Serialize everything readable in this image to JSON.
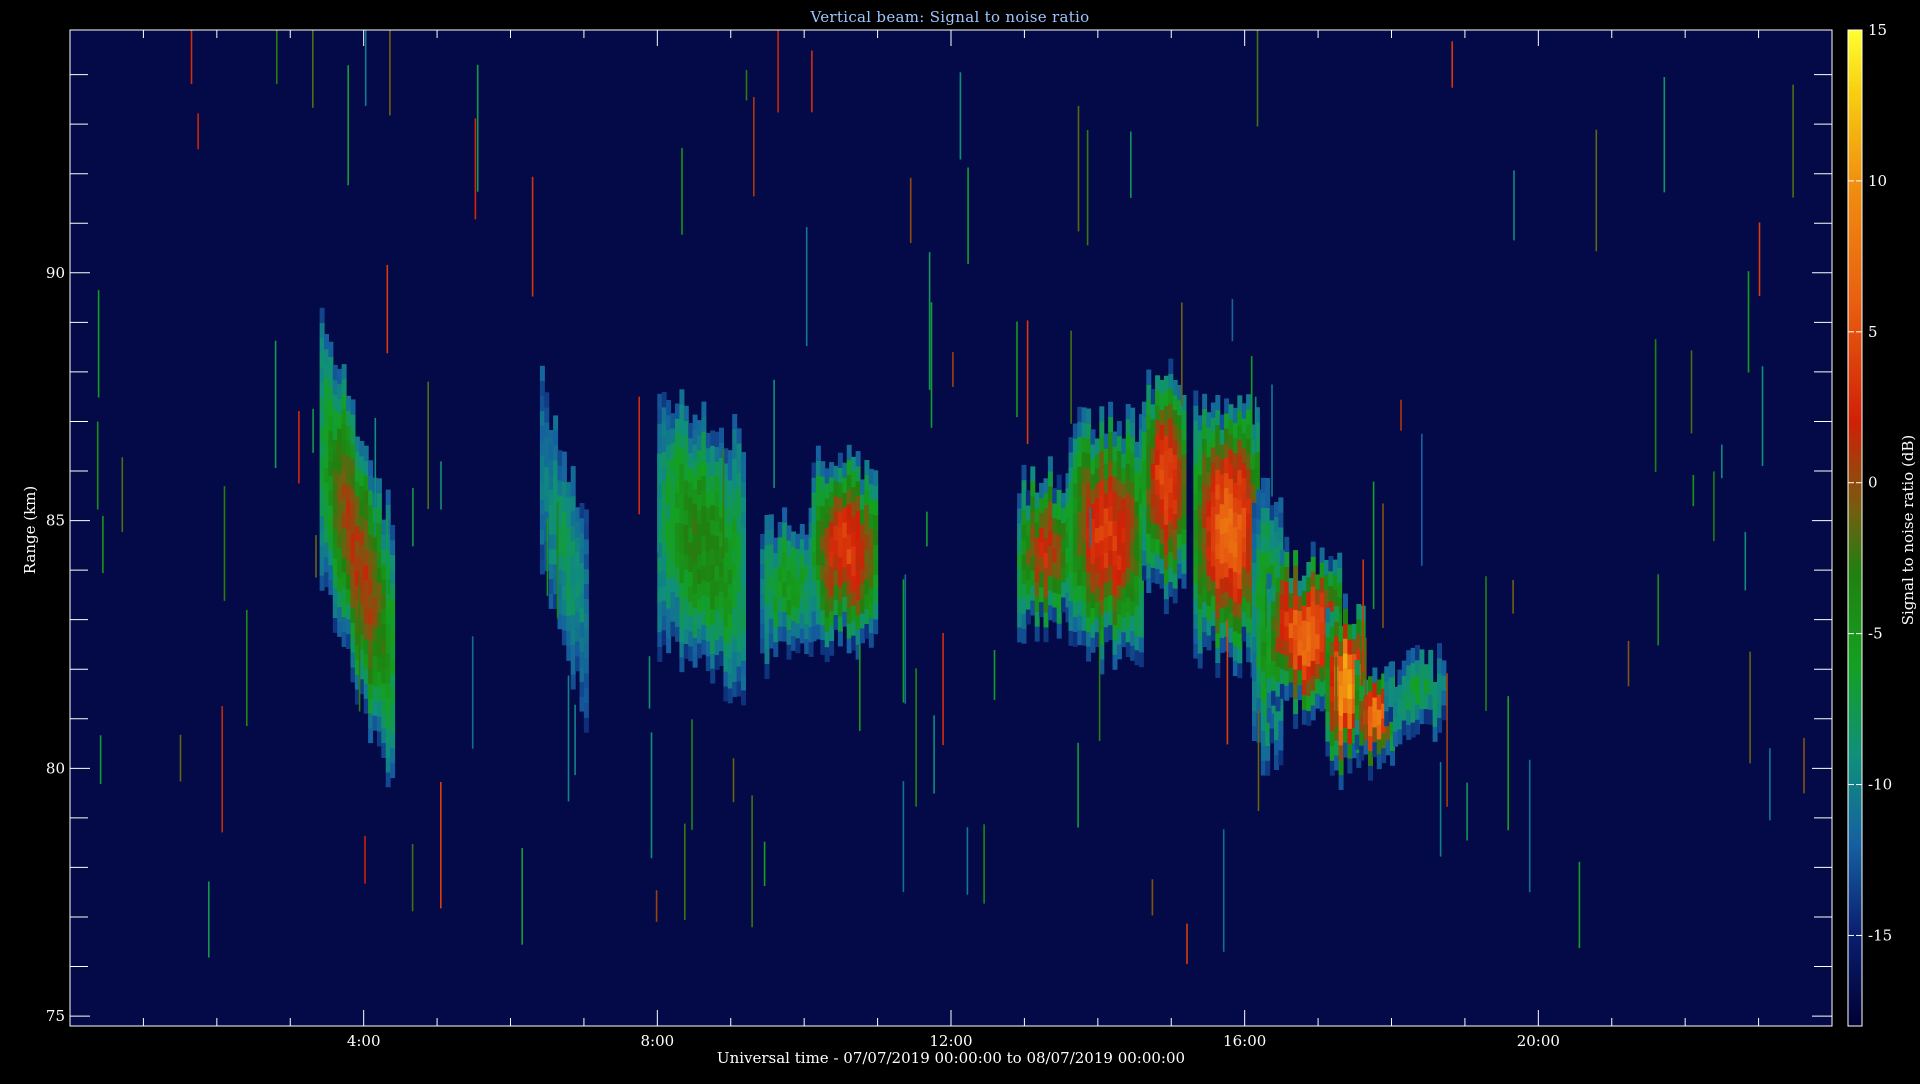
{
  "chart_data": {
    "type": "heatmap",
    "title": "Vertical beam: Signal to noise ratio",
    "xlabel": "Universal time - 07/07/2019 00:00:00 to 08/07/2019 00:00:00",
    "ylabel": "Range (km)",
    "colorbar_label": "Signal to noise ratio (dB)",
    "x_unit": "hours UT",
    "xlim": [
      0,
      24
    ],
    "ylim": [
      74.8,
      94.9
    ],
    "clim": [
      -18,
      15
    ],
    "x_ticks": [
      {
        "value": 4,
        "label": "4:00"
      },
      {
        "value": 8,
        "label": "8:00"
      },
      {
        "value": 12,
        "label": "12:00"
      },
      {
        "value": 16,
        "label": "16:00"
      },
      {
        "value": 20,
        "label": "20:00"
      }
    ],
    "y_ticks": [
      {
        "value": 75,
        "label": "75"
      },
      {
        "value": 80,
        "label": "80"
      },
      {
        "value": 85,
        "label": "85"
      },
      {
        "value": 90,
        "label": "90"
      }
    ],
    "colorbar_ticks": [
      {
        "value": 15,
        "label": "15"
      },
      {
        "value": 10,
        "label": "10"
      },
      {
        "value": 5,
        "label": "5"
      },
      {
        "value": 0,
        "label": "0"
      },
      {
        "value": -5,
        "label": "-5"
      },
      {
        "value": -10,
        "label": "-10"
      },
      {
        "value": -15,
        "label": "-15"
      }
    ],
    "background_snr_db": -17,
    "colormap": [
      {
        "value": -18,
        "color": "#000033"
      },
      {
        "value": -15,
        "color": "#0a1e6e"
      },
      {
        "value": -12,
        "color": "#1560a0"
      },
      {
        "value": -9,
        "color": "#10907a"
      },
      {
        "value": -6,
        "color": "#14a020"
      },
      {
        "value": -3,
        "color": "#208010"
      },
      {
        "value": -1,
        "color": "#706010"
      },
      {
        "value": 2,
        "color": "#d02008"
      },
      {
        "value": 6,
        "color": "#e86010"
      },
      {
        "value": 10,
        "color": "#f09010"
      },
      {
        "value": 13,
        "color": "#f8d010"
      },
      {
        "value": 15,
        "color": "#ffff30"
      }
    ],
    "echo_regions": [
      {
        "t0": 3.4,
        "t1": 4.4,
        "r_top": 86.8,
        "r_bot": 81.5,
        "peak_db": 1,
        "slant": -4.5
      },
      {
        "t0": 6.4,
        "t1": 7.0,
        "r_top": 86.2,
        "r_bot": 82.5,
        "peak_db": -8,
        "slant": -3
      },
      {
        "t0": 8.0,
        "t1": 9.2,
        "r_top": 86.9,
        "r_bot": 82.0,
        "peak_db": -3,
        "slant": -1
      },
      {
        "t0": 9.4,
        "t1": 10.1,
        "r_top": 84.7,
        "r_bot": 82.2,
        "peak_db": -5,
        "slant": 0
      },
      {
        "t0": 10.1,
        "t1": 11.0,
        "r_top": 86.0,
        "r_bot": 82.5,
        "peak_db": 4,
        "slant": 0
      },
      {
        "t0": 12.9,
        "t1": 13.6,
        "r_top": 85.7,
        "r_bot": 82.8,
        "peak_db": 2,
        "slant": 0
      },
      {
        "t0": 13.6,
        "t1": 14.6,
        "r_top": 86.8,
        "r_bot": 82.3,
        "peak_db": 4,
        "slant": 0
      },
      {
        "t0": 14.6,
        "t1": 15.2,
        "r_top": 87.7,
        "r_bot": 83.5,
        "peak_db": 5,
        "slant": 0
      },
      {
        "t0": 15.3,
        "t1": 16.2,
        "r_top": 87.3,
        "r_bot": 82.2,
        "peak_db": 7,
        "slant": 0
      },
      {
        "t0": 16.1,
        "t1": 16.5,
        "r_top": 85.2,
        "r_bot": 80.2,
        "peak_db": -4,
        "slant": 0
      },
      {
        "t0": 16.3,
        "t1": 17.3,
        "r_top": 84.0,
        "r_bot": 81.2,
        "peak_db": 7,
        "slant": 0
      },
      {
        "t0": 17.1,
        "t1": 17.6,
        "r_top": 83.0,
        "r_bot": 79.9,
        "peak_db": 11,
        "slant": 0
      },
      {
        "t0": 17.5,
        "t1": 18.0,
        "r_top": 81.8,
        "r_bot": 80.1,
        "peak_db": 8,
        "slant": 0
      },
      {
        "t0": 17.9,
        "t1": 18.7,
        "r_top": 82.0,
        "r_bot": 80.6,
        "peak_db": -7,
        "slant": 0
      }
    ]
  }
}
